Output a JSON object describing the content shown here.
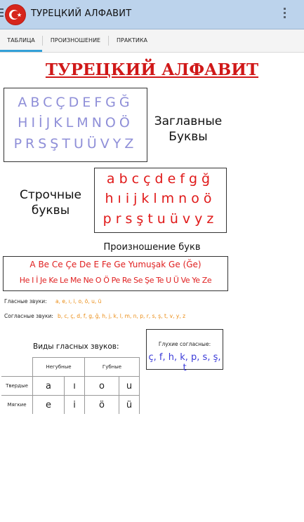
{
  "app": {
    "title": "ТУРЕЦКИЙ АЛФАВИТ"
  },
  "tabs": [
    {
      "label": "ТАБЛИЦА",
      "active": true
    },
    {
      "label": "ПРОИЗНОШЕНИЕ",
      "active": false
    },
    {
      "label": "ПРАКТИКА",
      "active": false
    }
  ],
  "content": {
    "title": "ТУРЕЦКИЙ АЛФАВИТ",
    "uppercase_rows": [
      "ABCÇDEFGĞ",
      "HIİJKLMNOÖ",
      "PRSŞTUÜVYZ"
    ],
    "uppercase_caption_1": "Заглавные",
    "uppercase_caption_2": "Буквы",
    "lowercase_rows": [
      "abcçdefgğ",
      "hıijklmnoö",
      "prsştuüvyz"
    ],
    "lowercase_caption_1": "Строчные",
    "lowercase_caption_2": "буквы",
    "pronunciation": {
      "title": "Произношение букв",
      "row1": "A Be Ce Çe De E Fe Ge Yumuşak Ge (Ğe)",
      "row2": "He I İ Je Ke Le Me Ne O Ö Pe Re Se Şe Te U Ü Ve Ye Ze"
    },
    "vowels_label": "Гласные звуки:",
    "vowels_value": "a, e, ı, i, o, ö, u, ü",
    "consonants_label": "Согласные звуки:",
    "consonants_value": "b, c, ç, d, f, g, ğ, h, j, k, l, m, n, p, r, s, ş, t, v, y, z",
    "vowel_types": {
      "heading": "Виды гласных звуков:",
      "col_unrounded": "Негубные",
      "col_rounded": "Губные",
      "rows": [
        {
          "name": "Твердые",
          "cells": [
            "a",
            "ı",
            "o",
            "u"
          ]
        },
        {
          "name": "Мягкие",
          "cells": [
            "e",
            "i",
            "ö",
            "ü"
          ]
        }
      ]
    },
    "voiceless": {
      "title": "Глухие согласные:",
      "list": "ç, f, h, k, p, s, ş, t"
    }
  },
  "colors": {
    "appbar": "#bcd3ec",
    "tab_indicator": "#33a0d8",
    "title_red": "#d01818",
    "uppercase_letters": "#8f8fd8",
    "lowercase_letters": "#e01919",
    "orange": "#ea8a10",
    "voiceless_blue": "#3a3ad8"
  },
  "icons": [
    "nav-drawer-icon",
    "turkish-flag-icon",
    "overflow-menu-icon"
  ]
}
